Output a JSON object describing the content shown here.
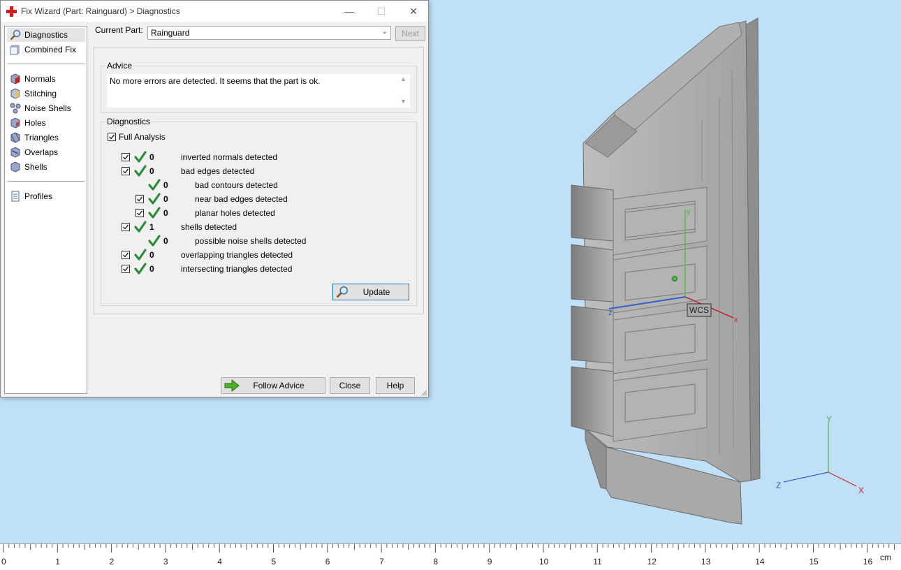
{
  "window": {
    "title": "Fix Wizard (Part: Rainguard) > Diagnostics",
    "minimize": "—",
    "maximize": "☐",
    "close": "✕"
  },
  "sidebar": {
    "items": [
      {
        "label": "Diagnostics",
        "icon": "magnifier-icon",
        "selected": true
      },
      {
        "label": "Combined Fix",
        "icon": "combined-fix-icon"
      },
      {
        "label": "Normals",
        "icon": "normals-cube-icon"
      },
      {
        "label": "Stitching",
        "icon": "stitching-cube-icon"
      },
      {
        "label": "Noise Shells",
        "icon": "noise-shells-icon"
      },
      {
        "label": "Holes",
        "icon": "holes-cube-icon"
      },
      {
        "label": "Triangles",
        "icon": "triangles-cube-icon"
      },
      {
        "label": "Overlaps",
        "icon": "overlaps-cube-icon"
      },
      {
        "label": "Shells",
        "icon": "shells-cube-icon"
      },
      {
        "label": "Profiles",
        "icon": "profiles-document-icon"
      }
    ]
  },
  "current_part": {
    "label": "Current Part:",
    "value": "Rainguard"
  },
  "next_label": "Next",
  "advice": {
    "title": "Advice",
    "text": "No more errors are detected. It seems that the part is ok."
  },
  "diagnostics": {
    "title": "Diagnostics",
    "full_analysis": "Full Analysis",
    "rows": [
      {
        "count": "0",
        "label": "inverted normals detected",
        "checkbox": true,
        "checked": true,
        "indent": 0
      },
      {
        "count": "0",
        "label": "bad edges detected",
        "checkbox": true,
        "checked": true,
        "indent": 0
      },
      {
        "count": "0",
        "label": "bad contours detected",
        "checkbox": false,
        "indent": 1
      },
      {
        "count": "0",
        "label": "near bad edges detected",
        "checkbox": true,
        "checked": true,
        "indent": 1
      },
      {
        "count": "0",
        "label": "planar holes detected",
        "checkbox": true,
        "checked": true,
        "indent": 1
      },
      {
        "count": "1",
        "label": "shells detected",
        "checkbox": true,
        "checked": true,
        "indent": 0
      },
      {
        "count": "0",
        "label": "possible noise shells detected",
        "checkbox": false,
        "indent": 1
      },
      {
        "count": "0",
        "label": "overlapping triangles detected",
        "checkbox": true,
        "checked": true,
        "indent": 0
      },
      {
        "count": "0",
        "label": "intersecting triangles detected",
        "checkbox": true,
        "checked": true,
        "indent": 0
      }
    ]
  },
  "buttons": {
    "update": "Update",
    "follow_advice": "Follow Advice",
    "close": "Close",
    "help": "Help"
  },
  "viewport": {
    "wcs_label": "WCS",
    "axis_labels": {
      "y": "Y",
      "z": "Z",
      "x": "X",
      "x_small": "x",
      "y_small": "y",
      "z_small": "z"
    },
    "colors": {
      "background": "#bfe0f7",
      "x_axis": "#c0282d",
      "y_axis": "#4cb84c",
      "z_axis": "#3060c8",
      "part": "#a8a8a8"
    }
  },
  "ruler": {
    "labels": [
      "0",
      "1",
      "2",
      "3",
      "4",
      "5",
      "6",
      "7",
      "8",
      "9",
      "10",
      "11",
      "12",
      "13",
      "14",
      "15",
      "16"
    ],
    "unit": "cm"
  }
}
